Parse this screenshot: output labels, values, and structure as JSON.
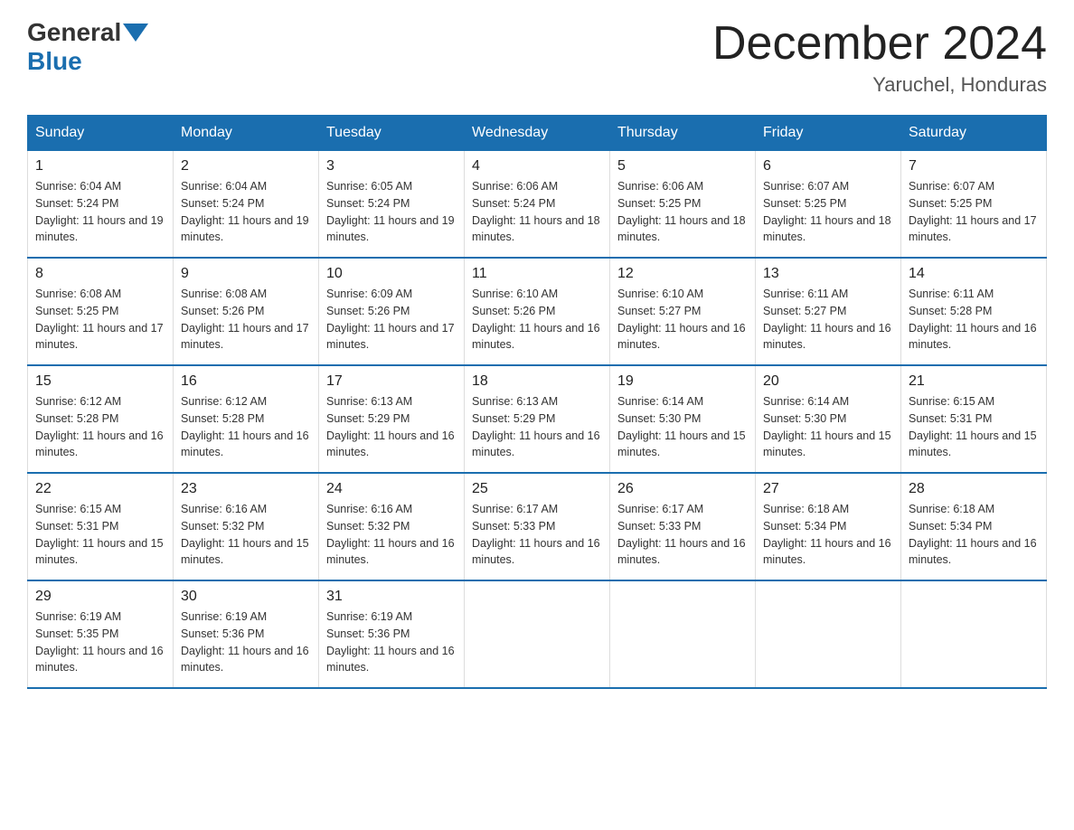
{
  "logo": {
    "general": "General",
    "blue": "Blue"
  },
  "header": {
    "title": "December 2024",
    "location": "Yaruchel, Honduras"
  },
  "weekdays": [
    "Sunday",
    "Monday",
    "Tuesday",
    "Wednesday",
    "Thursday",
    "Friday",
    "Saturday"
  ],
  "weeks": [
    [
      {
        "day": "1",
        "sunrise": "6:04 AM",
        "sunset": "5:24 PM",
        "daylight": "11 hours and 19 minutes."
      },
      {
        "day": "2",
        "sunrise": "6:04 AM",
        "sunset": "5:24 PM",
        "daylight": "11 hours and 19 minutes."
      },
      {
        "day": "3",
        "sunrise": "6:05 AM",
        "sunset": "5:24 PM",
        "daylight": "11 hours and 19 minutes."
      },
      {
        "day": "4",
        "sunrise": "6:06 AM",
        "sunset": "5:24 PM",
        "daylight": "11 hours and 18 minutes."
      },
      {
        "day": "5",
        "sunrise": "6:06 AM",
        "sunset": "5:25 PM",
        "daylight": "11 hours and 18 minutes."
      },
      {
        "day": "6",
        "sunrise": "6:07 AM",
        "sunset": "5:25 PM",
        "daylight": "11 hours and 18 minutes."
      },
      {
        "day": "7",
        "sunrise": "6:07 AM",
        "sunset": "5:25 PM",
        "daylight": "11 hours and 17 minutes."
      }
    ],
    [
      {
        "day": "8",
        "sunrise": "6:08 AM",
        "sunset": "5:25 PM",
        "daylight": "11 hours and 17 minutes."
      },
      {
        "day": "9",
        "sunrise": "6:08 AM",
        "sunset": "5:26 PM",
        "daylight": "11 hours and 17 minutes."
      },
      {
        "day": "10",
        "sunrise": "6:09 AM",
        "sunset": "5:26 PM",
        "daylight": "11 hours and 17 minutes."
      },
      {
        "day": "11",
        "sunrise": "6:10 AM",
        "sunset": "5:26 PM",
        "daylight": "11 hours and 16 minutes."
      },
      {
        "day": "12",
        "sunrise": "6:10 AM",
        "sunset": "5:27 PM",
        "daylight": "11 hours and 16 minutes."
      },
      {
        "day": "13",
        "sunrise": "6:11 AM",
        "sunset": "5:27 PM",
        "daylight": "11 hours and 16 minutes."
      },
      {
        "day": "14",
        "sunrise": "6:11 AM",
        "sunset": "5:28 PM",
        "daylight": "11 hours and 16 minutes."
      }
    ],
    [
      {
        "day": "15",
        "sunrise": "6:12 AM",
        "sunset": "5:28 PM",
        "daylight": "11 hours and 16 minutes."
      },
      {
        "day": "16",
        "sunrise": "6:12 AM",
        "sunset": "5:28 PM",
        "daylight": "11 hours and 16 minutes."
      },
      {
        "day": "17",
        "sunrise": "6:13 AM",
        "sunset": "5:29 PM",
        "daylight": "11 hours and 16 minutes."
      },
      {
        "day": "18",
        "sunrise": "6:13 AM",
        "sunset": "5:29 PM",
        "daylight": "11 hours and 16 minutes."
      },
      {
        "day": "19",
        "sunrise": "6:14 AM",
        "sunset": "5:30 PM",
        "daylight": "11 hours and 15 minutes."
      },
      {
        "day": "20",
        "sunrise": "6:14 AM",
        "sunset": "5:30 PM",
        "daylight": "11 hours and 15 minutes."
      },
      {
        "day": "21",
        "sunrise": "6:15 AM",
        "sunset": "5:31 PM",
        "daylight": "11 hours and 15 minutes."
      }
    ],
    [
      {
        "day": "22",
        "sunrise": "6:15 AM",
        "sunset": "5:31 PM",
        "daylight": "11 hours and 15 minutes."
      },
      {
        "day": "23",
        "sunrise": "6:16 AM",
        "sunset": "5:32 PM",
        "daylight": "11 hours and 15 minutes."
      },
      {
        "day": "24",
        "sunrise": "6:16 AM",
        "sunset": "5:32 PM",
        "daylight": "11 hours and 16 minutes."
      },
      {
        "day": "25",
        "sunrise": "6:17 AM",
        "sunset": "5:33 PM",
        "daylight": "11 hours and 16 minutes."
      },
      {
        "day": "26",
        "sunrise": "6:17 AM",
        "sunset": "5:33 PM",
        "daylight": "11 hours and 16 minutes."
      },
      {
        "day": "27",
        "sunrise": "6:18 AM",
        "sunset": "5:34 PM",
        "daylight": "11 hours and 16 minutes."
      },
      {
        "day": "28",
        "sunrise": "6:18 AM",
        "sunset": "5:34 PM",
        "daylight": "11 hours and 16 minutes."
      }
    ],
    [
      {
        "day": "29",
        "sunrise": "6:19 AM",
        "sunset": "5:35 PM",
        "daylight": "11 hours and 16 minutes."
      },
      {
        "day": "30",
        "sunrise": "6:19 AM",
        "sunset": "5:36 PM",
        "daylight": "11 hours and 16 minutes."
      },
      {
        "day": "31",
        "sunrise": "6:19 AM",
        "sunset": "5:36 PM",
        "daylight": "11 hours and 16 minutes."
      },
      null,
      null,
      null,
      null
    ]
  ],
  "labels": {
    "sunrise": "Sunrise: ",
    "sunset": "Sunset: ",
    "daylight": "Daylight: "
  }
}
